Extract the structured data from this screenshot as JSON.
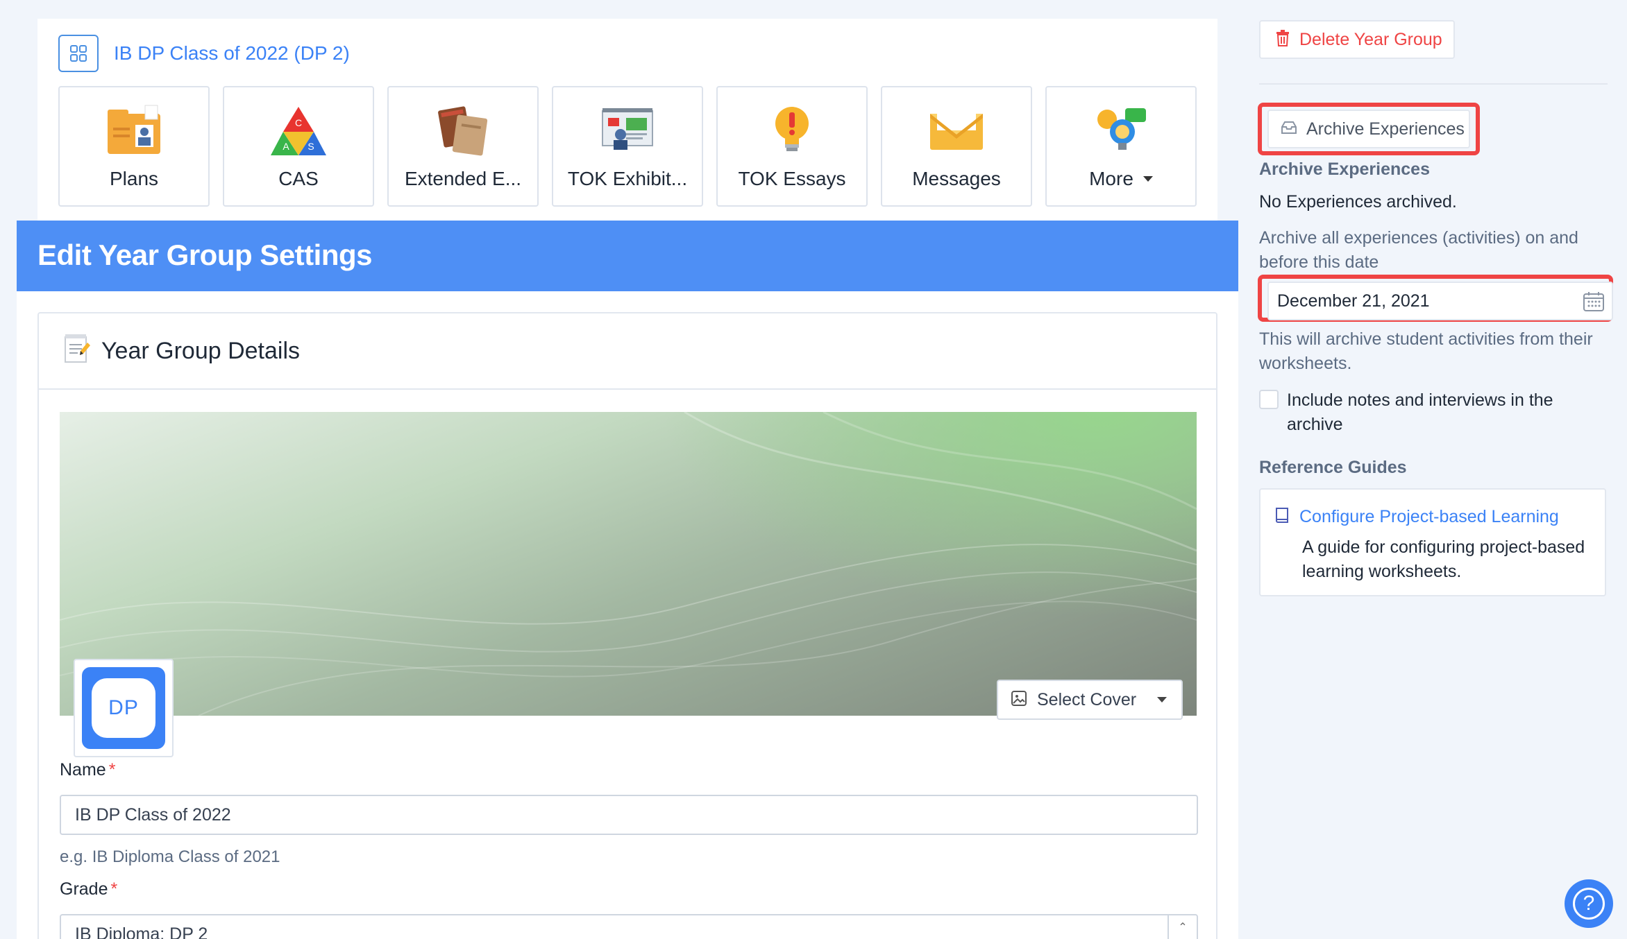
{
  "header": {
    "group_title": "IB DP Class of 2022 (DP 2)",
    "grid_icon": "grid-icon"
  },
  "tiles": [
    {
      "label": "Plans",
      "icon": "plans-folder-icon"
    },
    {
      "label": "CAS",
      "icon": "cas-triangle-icon"
    },
    {
      "label": "Extended E...",
      "icon": "books-icon"
    },
    {
      "label": "TOK Exhibit...",
      "icon": "presentation-icon"
    },
    {
      "label": "TOK Essays",
      "icon": "lightbulb-exclamation-icon"
    },
    {
      "label": "Messages",
      "icon": "envelope-icon"
    },
    {
      "label": "More",
      "icon": "idea-chat-icon"
    }
  ],
  "cas_letters": {
    "c": "C",
    "a": "A",
    "s": "S"
  },
  "banner": {
    "title": "Edit Year Group Settings"
  },
  "details": {
    "heading": "Year Group Details",
    "heading_icon": "memo-icon",
    "avatar_text": "DP",
    "select_cover_label": "Select Cover",
    "name_label": "Name",
    "name_required": "*",
    "name_value": "IB DP Class of 2022",
    "name_hint": "e.g. IB Diploma Class of 2021",
    "grade_label": "Grade",
    "grade_required": "*",
    "grade_value": "IB Diploma: DP 2"
  },
  "sidebar": {
    "delete_label": "Delete Year Group",
    "archive_button_label": "Archive Experiences",
    "archive_heading": "Archive Experiences",
    "archive_status": "No Experiences archived.",
    "archive_description": "Archive all experiences (activities) on and before this date",
    "archive_date": "December 21, 2021",
    "archive_note": "This will archive student activities from their worksheets.",
    "include_notes_label": "Include notes and interviews in the archive",
    "include_notes_checked": false,
    "reference_heading": "Reference Guides",
    "guide_title": "Configure Project-based Learning",
    "guide_description": "A guide for configuring project-based learning worksheets."
  },
  "help": {
    "label": "?"
  },
  "colors": {
    "accent": "#3b82f6",
    "banner": "#4e8ff5",
    "danger": "#ef4444",
    "highlight_box": "#ef4444"
  }
}
